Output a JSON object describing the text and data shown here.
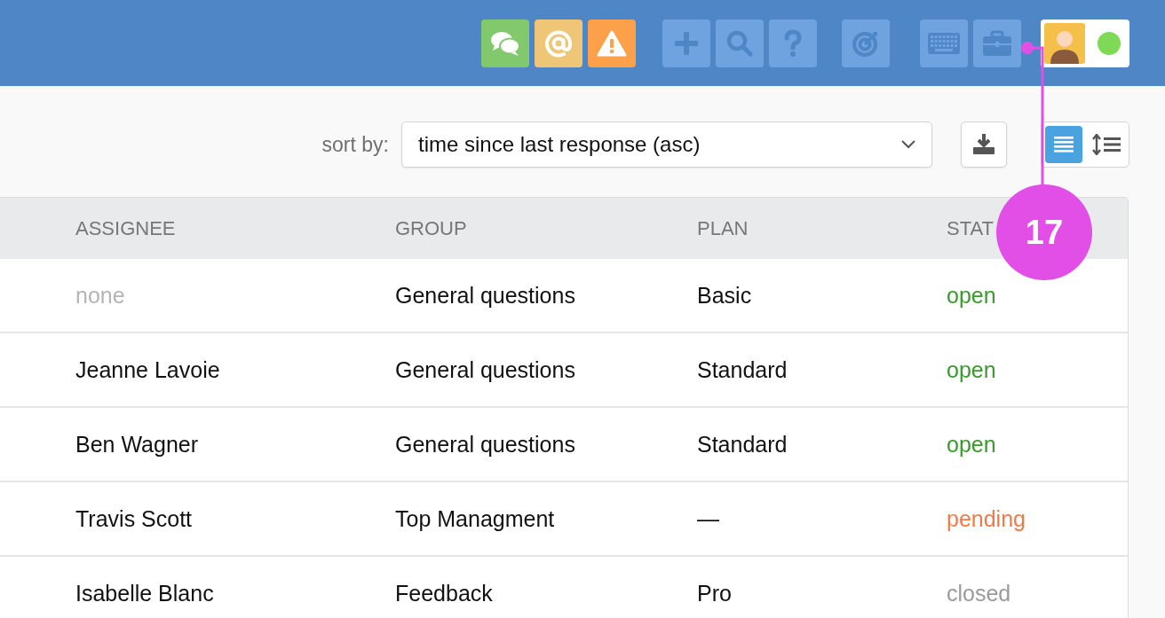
{
  "topbar": {
    "alerts": [
      {
        "kind": "chat"
      },
      {
        "kind": "mention"
      },
      {
        "kind": "warning"
      }
    ],
    "tools": [
      {
        "kind": "add"
      },
      {
        "kind": "search"
      },
      {
        "kind": "help"
      },
      {
        "kind": "target"
      },
      {
        "kind": "keyboard"
      },
      {
        "kind": "briefcase"
      }
    ],
    "user": {
      "online": true
    }
  },
  "callout": {
    "number": "17"
  },
  "toolbar": {
    "sort_label": "sort by:",
    "sort_value": "time since last response (asc)",
    "views": [
      {
        "kind": "list",
        "selected": true
      },
      {
        "kind": "spacing",
        "selected": false
      }
    ]
  },
  "table": {
    "columns": [
      "ASSIGNEE",
      "GROUP",
      "PLAN",
      "STAT"
    ],
    "rows": [
      {
        "assignee": {
          "text": "none",
          "empty": true
        },
        "group": "General questions",
        "plan": "Basic",
        "status": {
          "text": "open",
          "color": "#3a9a2e"
        }
      },
      {
        "assignee": {
          "text": "Jeanne Lavoie",
          "empty": false
        },
        "group": "General questions",
        "plan": "Standard",
        "status": {
          "text": "open",
          "color": "#3a9a2e"
        }
      },
      {
        "assignee": {
          "text": "Ben Wagner",
          "empty": false
        },
        "group": "General questions",
        "plan": "Standard",
        "status": {
          "text": "open",
          "color": "#3a9a2e"
        }
      },
      {
        "assignee": {
          "text": "Travis Scott",
          "empty": false
        },
        "group": "Top Managment",
        "plan": "—",
        "status": {
          "text": "pending",
          "color": "#f07b4a"
        }
      },
      {
        "assignee": {
          "text": "Isabelle Blanc",
          "empty": false
        },
        "group": "Feedback",
        "plan": "Pro",
        "status": {
          "text": "closed",
          "color": "#9a9a9a"
        }
      }
    ]
  }
}
